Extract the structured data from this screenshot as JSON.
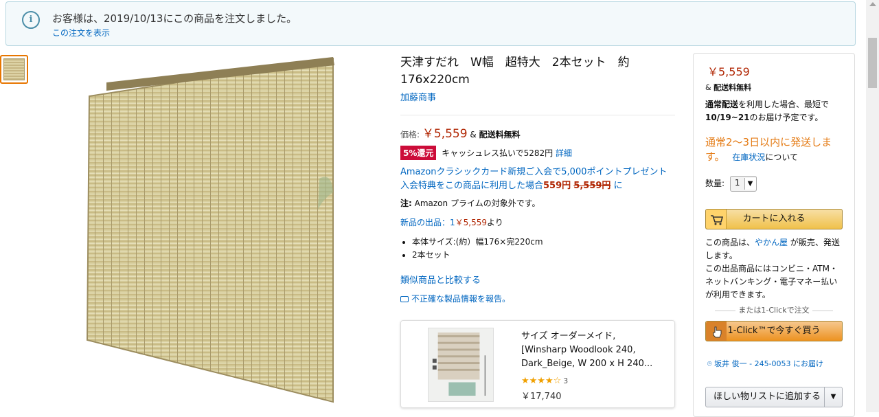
{
  "notice": {
    "message": "お客様は、2019/10/13にこの商品を注文しました。",
    "view_order": "この注文を表示"
  },
  "product": {
    "title": "天津すだれ　W幅　超特大　2本セット　約176x220cm",
    "brand": "加藤商事",
    "price_label": "価格:",
    "price": "￥5,559",
    "shipping_amp": "&",
    "shipping_free": "配送料無料",
    "badge": "5%還元",
    "cashless_text": "キャッシュレス払いで5282円",
    "cashless_detail": "詳細",
    "promo_line1": "Amazonクラシックカード新規ご入会で5,000ポイントプレゼント",
    "promo_line2_a": "入会特典をこの商品に利用した場合",
    "promo_line2_price": "559円",
    "promo_line2_old": "5,559円",
    "promo_line2_b": "に",
    "note_label": "注:",
    "note_text": " Amazon プライムの対象外です。",
    "offers_a": "新品の出品：1",
    "offers_price": "￥5,559",
    "offers_b": "より",
    "bullets": [
      "本体サイズ:(約）幅176×完220cm",
      "2本セット"
    ],
    "compare": "類似商品と比較する",
    "report": "不正確な製品情報を報告。"
  },
  "sponsored": {
    "title": "サイズ オーダーメイド, [Winsharp Woodlook 240, Dark_Beige, W 200 x H 240...",
    "stars": "★★★★☆",
    "rating": 4,
    "review_count": "3",
    "price": "￥17,740"
  },
  "buybox": {
    "price": "￥5,559",
    "ship_amp": "&",
    "ship_free": "配送料無料",
    "delivery_a": "通常配送",
    "delivery_b": "を利用した場合、最短で",
    "delivery_date": "10/19~21",
    "delivery_c": "のお届け予定です。",
    "availability": "通常2～3日以内に発送します。",
    "stock_link": "在庫状況",
    "stock_suffix": "について",
    "qty_label": "数量:",
    "qty_value": "1",
    "cart_button": "カートに入れる",
    "sold_a": "この商品は、",
    "seller": "やかん屋",
    "sold_b": " が販売、発送します。",
    "sold_c": "この出品商品にはコンビニ・ATM・ネットバンキング・電子マネー払いが利用できます。",
    "or_text": "または1-Clickで注文",
    "oneclick_button": "1-Click™で今すぐ買う",
    "deliver_to": "坂井 俊一 - 245-0053 にお届け",
    "wishlist_button": "ほしい物リストに追加する"
  }
}
